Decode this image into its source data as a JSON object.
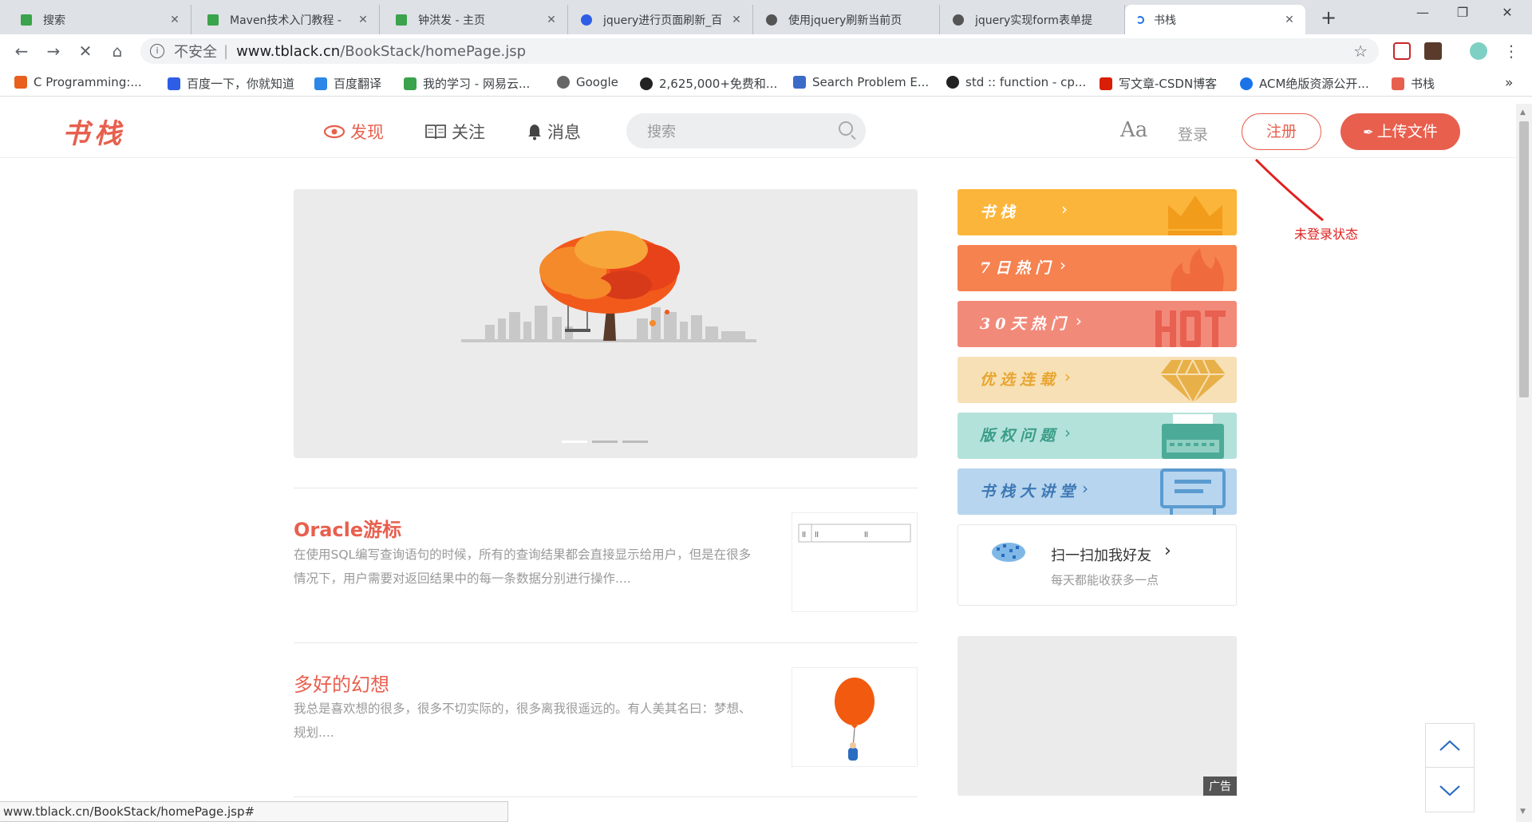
{
  "browser": {
    "tabs": [
      {
        "title": "搜索",
        "favicon_color": "#3aa34b"
      },
      {
        "title": "Maven技术入门教程 -",
        "favicon_color": "#3aa34b"
      },
      {
        "title": "钟洪发 - 主页",
        "favicon_color": "#3aa34b"
      },
      {
        "title": "jquery进行页面刷新_百",
        "favicon_color": "#2e5ee6"
      },
      {
        "title": "使用jquery刷新当前页",
        "favicon_color": "#555555"
      },
      {
        "title": "jquery实现form表单提",
        "favicon_color": "#555555"
      },
      {
        "title": "书栈",
        "favicon_color": "#1a73e8",
        "active": true
      }
    ],
    "new_tab_label": "+",
    "address": {
      "insecure_label": "不安全",
      "separator": "|",
      "host": "www.tblack.cn",
      "path": "/BookStack/homePage.jsp"
    },
    "bookmarks": [
      {
        "label": "C Programming:...",
        "icon_color": "#e85f1e"
      },
      {
        "label": "百度一下，你就知道",
        "icon_color": "#2e5ee6"
      },
      {
        "label": "百度翻译",
        "icon_color": "#2e86e6"
      },
      {
        "label": "我的学习 - 网易云...",
        "icon_color": "#3aa34b"
      },
      {
        "label": "Google",
        "icon_color": "#666666"
      },
      {
        "label": "2,625,000+免费和...",
        "icon_color": "#222222"
      },
      {
        "label": "Search Problem E...",
        "icon_color": "#3a6bc8"
      },
      {
        "label": "std :: function - cp...",
        "icon_color": "#222222"
      },
      {
        "label": "写文章-CSDN博客",
        "icon_color": "#d81e06"
      },
      {
        "label": "ACM绝版资源公开...",
        "icon_color": "#1a73e8"
      },
      {
        "label": "书栈",
        "icon_color": "#e85f4e"
      }
    ],
    "bookmarks_overflow": "»",
    "status_url": "www.tblack.cn/BookStack/homePage.jsp#"
  },
  "site": {
    "logo": "书栈",
    "nav": [
      {
        "label": "发现",
        "active": true
      },
      {
        "label": "关注",
        "active": false
      },
      {
        "label": "消息",
        "active": false
      }
    ],
    "search_placeholder": "搜索",
    "font_button": "Aa",
    "login": "登录",
    "register": "注册",
    "upload": "上传文件",
    "accent_color": "#e85f4e"
  },
  "carousel": {
    "slides": 3,
    "active_index": 0
  },
  "articles": [
    {
      "title": "Oracle游标",
      "desc": "在使用SQL编写查询语句的时候，所有的查询结果都会直接显示给用户，但是在很多情况下，用户需要对返回结果中的每一条数据分别进行操作...."
    },
    {
      "title": "多好的幻想",
      "desc": "我总是喜欢想的很多，很多不切实际的，很多离我很遥远的。有人美其名曰：梦想、规划...."
    }
  ],
  "sidebar": {
    "banners": [
      {
        "label": "书栈",
        "color": "#fcb53b",
        "text_color": "#fff",
        "icon": "crown-icon"
      },
      {
        "label": "7日热门",
        "color": "#f68250",
        "text_color": "#fff",
        "icon": "flame-icon"
      },
      {
        "label": "30天热门",
        "color": "#f28a7a",
        "text_color": "#fff",
        "icon": "hot-icon"
      },
      {
        "label": "优选连载",
        "color": "#f7e0b5",
        "text_color": "#e8a530",
        "icon": "diamond-icon"
      },
      {
        "label": "版权问题",
        "color": "#b3e2da",
        "text_color": "#3a9c88",
        "icon": "typewriter-icon"
      },
      {
        "label": "书栈大讲堂",
        "color": "#b7d5ee",
        "text_color": "#3d78b5",
        "icon": "screen-icon"
      }
    ],
    "qr_card": {
      "title": "扫一扫加我好友",
      "subtitle": "每天都能收获多一点"
    },
    "ad_label": "广告"
  },
  "annotation": {
    "text": "未登录状态",
    "color": "#e02020"
  }
}
